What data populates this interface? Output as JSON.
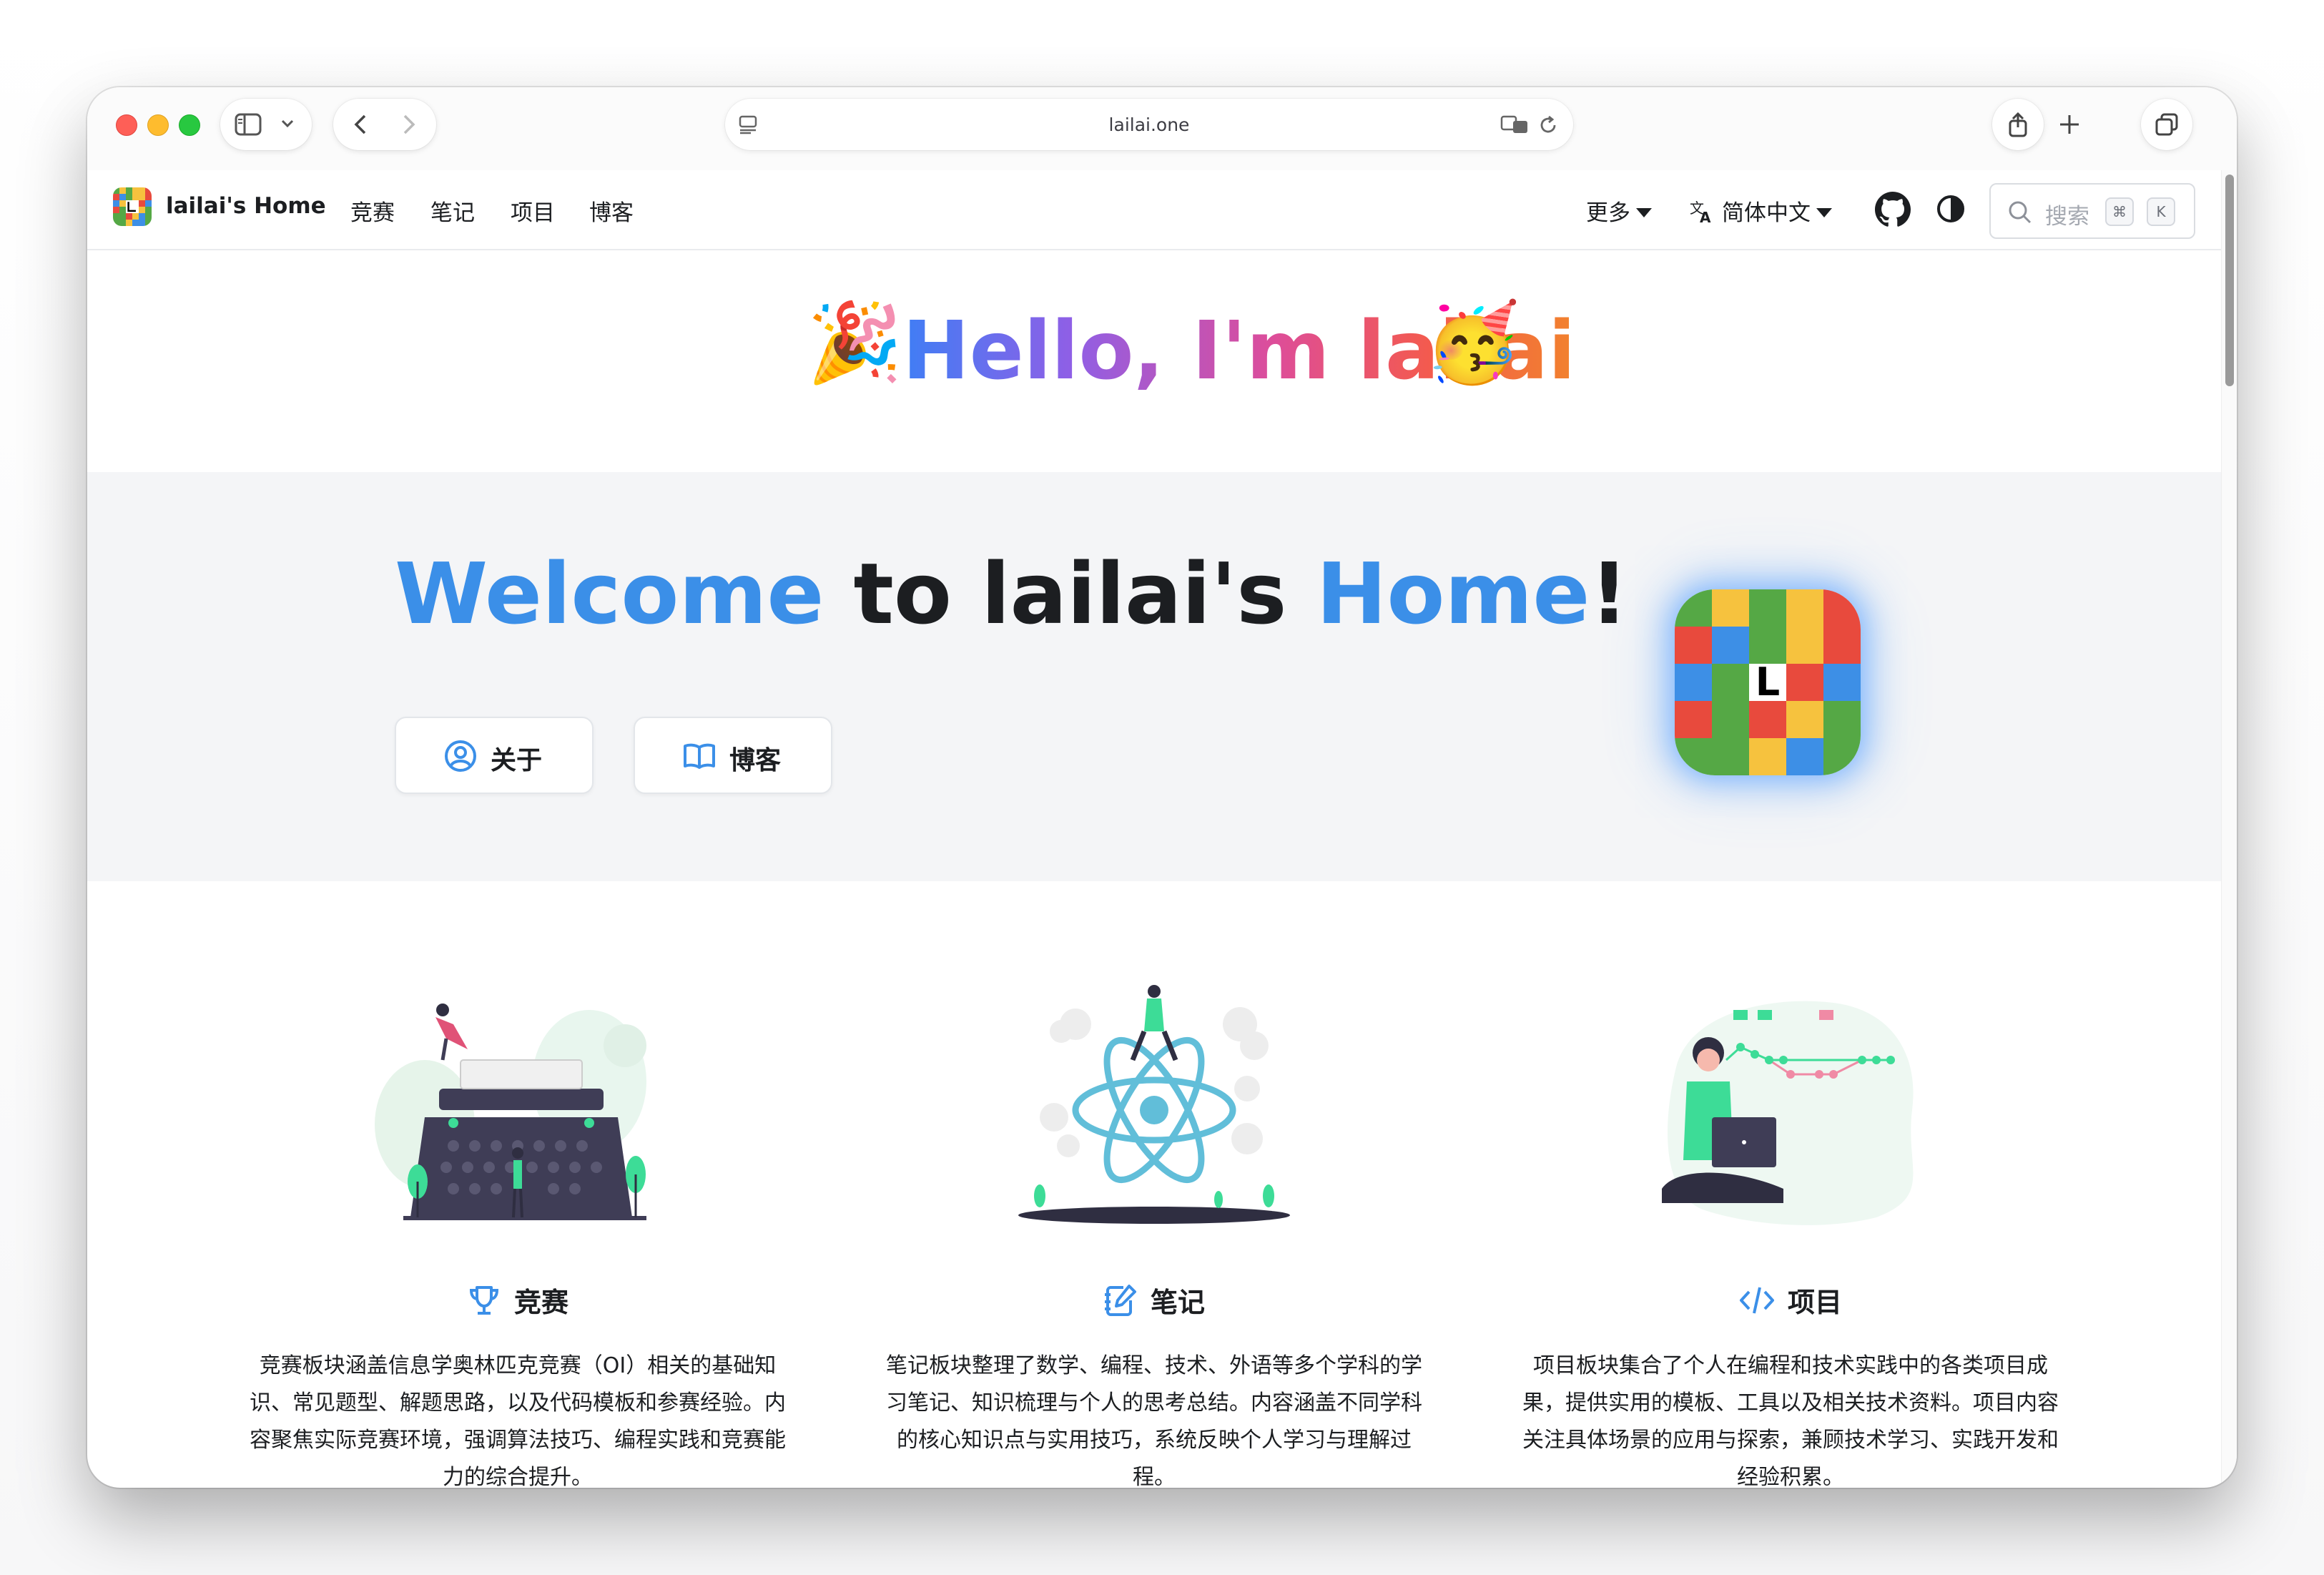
{
  "browser": {
    "url": "lailai.one"
  },
  "navbar": {
    "brand": "lailai's Home",
    "links": [
      "竞赛",
      "笔记",
      "项目",
      "博客"
    ],
    "more": "更多",
    "language": "简体中文",
    "search_placeholder": "搜索",
    "shortcut_keys": [
      "⌘",
      "K"
    ]
  },
  "banner": {
    "text": "Hello, I'm lailai",
    "emoji_left": "🎉",
    "emoji_right": "🥳"
  },
  "hero": {
    "title_part1": "Welcome",
    "title_part2": " to lailai's ",
    "title_part3": "Home",
    "title_part4": "!",
    "buttons": [
      {
        "label": "关于",
        "icon": "user-circle-icon"
      },
      {
        "label": "博客",
        "icon": "book-open-icon"
      }
    ],
    "logo_letter": "L"
  },
  "features": [
    {
      "icon": "trophy-icon",
      "title": "竞赛",
      "description": "竞赛板块涵盖信息学奥林匹克竞赛（OI）相关的基础知识、常见题型、解题思路，以及代码模板和参赛经验。内容聚焦实际竞赛环境，强调算法技巧、编程实践和竞赛能力的综合提升。"
    },
    {
      "icon": "note-edit-icon",
      "title": "笔记",
      "description": "笔记板块整理了数学、编程、技术、外语等多个学科的学习笔记、知识梳理与个人的思考总结。内容涵盖不同学科的核心知识点与实用技巧，系统反映个人学习与理解过程。"
    },
    {
      "icon": "code-icon",
      "title": "项目",
      "description": "项目板块集合了个人在编程和技术实践中的各类项目成果，提供实用的模板、工具以及相关技术资料。项目内容关注具体场景的应用与探索，兼顾技术学习、实践开发和经验积累。"
    }
  ],
  "colors": {
    "accent_blue": "#3b8fe8",
    "hero_bg": "#f4f5f7",
    "logo_red": "#e84a3d",
    "logo_yellow": "#f6c23e",
    "logo_green": "#55a845",
    "logo_blue": "#3d8fe6"
  }
}
